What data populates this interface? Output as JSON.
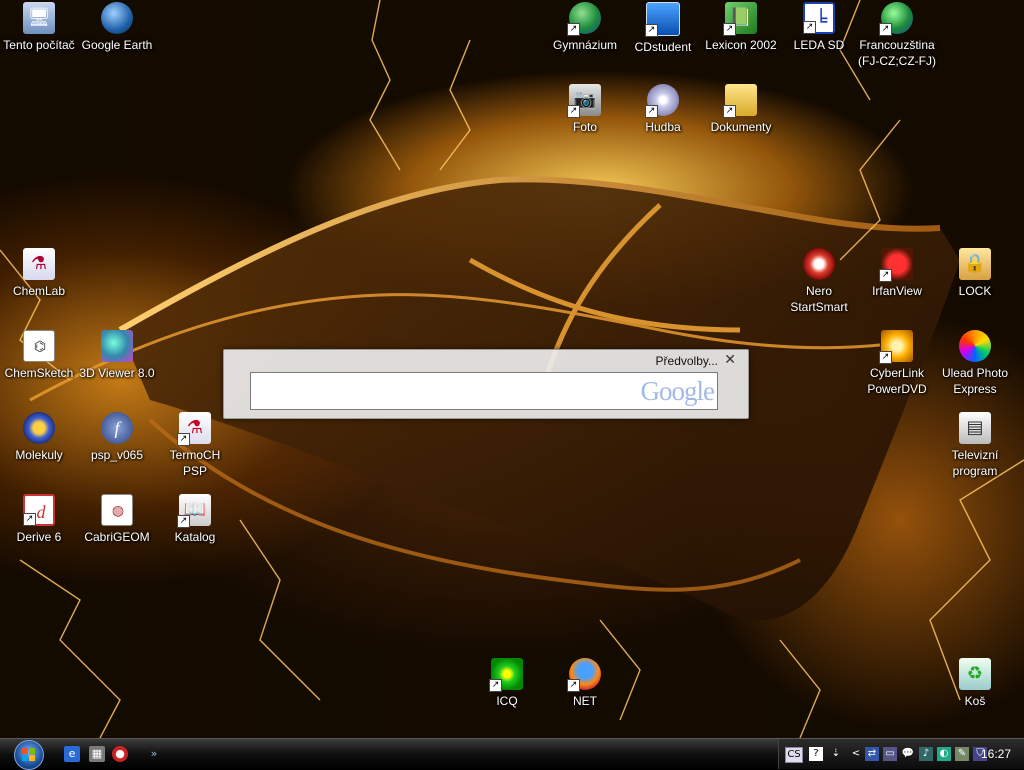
{
  "desktop": {
    "icons": [
      {
        "label": "Tento počítač",
        "icon": "computer-icon"
      },
      {
        "label": "Google Earth",
        "icon": "google-earth-icon"
      },
      {
        "label": "Gymnázium",
        "icon": "globe-icon"
      },
      {
        "label": "CDstudent",
        "icon": "cdstudent-icon"
      },
      {
        "label": "Lexicon 2002",
        "icon": "book-icon"
      },
      {
        "label": "LEDA SD",
        "icon": "leda-icon"
      },
      {
        "label": "Francouzština (FJ-CZ;CZ-FJ)",
        "icon": "flag-globe-icon"
      },
      {
        "label": "Foto",
        "icon": "camera-icon"
      },
      {
        "label": "Hudba",
        "icon": "music-cd-icon"
      },
      {
        "label": "Dokumenty",
        "icon": "documents-folder-icon"
      },
      {
        "label": "ChemLab",
        "icon": "chemlab-icon"
      },
      {
        "label": "Nero StartSmart",
        "icon": "nero-icon"
      },
      {
        "label": "IrfanView",
        "icon": "irfanview-icon"
      },
      {
        "label": "LOCK",
        "icon": "lock-user-icon"
      },
      {
        "label": "ChemSketch",
        "icon": "chemsketch-icon"
      },
      {
        "label": "3D Viewer 8.0",
        "icon": "molecule-viewer-icon"
      },
      {
        "label": "CyberLink PowerDVD",
        "icon": "powerdvd-icon"
      },
      {
        "label": "Ulead Photo Express",
        "icon": "ulead-icon"
      },
      {
        "label": "Molekuly",
        "icon": "gear-molecule-icon"
      },
      {
        "label": "psp_v065",
        "icon": "flash-icon"
      },
      {
        "label": "TermoCH PSP",
        "icon": "flask-icon"
      },
      {
        "label": "Televizní program",
        "icon": "tv-program-icon"
      },
      {
        "label": "Derive 6",
        "icon": "derive-icon"
      },
      {
        "label": "CabriGEOM",
        "icon": "cabri-icon"
      },
      {
        "label": "Katalog",
        "icon": "catalog-book-icon"
      },
      {
        "label": "ICQ",
        "icon": "icq-flower-icon"
      },
      {
        "label": "NET",
        "icon": "firefox-icon"
      },
      {
        "label": "Koš",
        "icon": "recycle-bin-icon"
      }
    ]
  },
  "gadget": {
    "preferences_label": "Předvolby...",
    "close_glyph": "✕",
    "search_value": "",
    "logo_text": "Google"
  },
  "taskbar": {
    "quicklaunch": [
      "ie-icon",
      "show-desktop-icon",
      "media-icon"
    ],
    "overflow_glyph": "»",
    "tray": {
      "language": "CS",
      "help": "?",
      "collapse_glyph": "<",
      "clock": "16:27"
    }
  },
  "colors": {
    "wallpaper_glow": "#ffb020",
    "taskbar": "#101010",
    "gadget_bg": "#ececec"
  }
}
